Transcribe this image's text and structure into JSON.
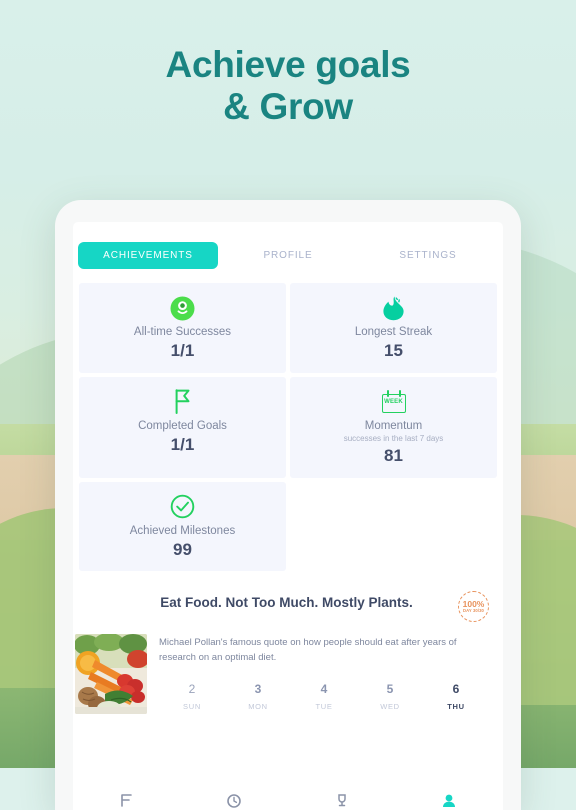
{
  "headline": {
    "line1": "Achieve goals",
    "line2": "& Grow"
  },
  "colors": {
    "headline_teal": "#1a8481",
    "tab_active_bg": "#16d6c5",
    "icon_green": "#3ddb52",
    "icon_teal": "#06cfa0",
    "badge_orange": "#e8925c",
    "card_bg": "#f4f6fd",
    "value_navy": "#454f6b"
  },
  "tabs": [
    {
      "label": "ACHIEVEMENTS",
      "active": true
    },
    {
      "label": "PROFILE",
      "active": false
    },
    {
      "label": "SETTINGS",
      "active": false
    }
  ],
  "stats": [
    {
      "icon": "monster-face-icon",
      "label": "All-time Successes",
      "sub": "",
      "value": "1/1"
    },
    {
      "icon": "flame-icon",
      "label": "Longest Streak",
      "sub": "",
      "value": "15"
    },
    {
      "icon": "flag-icon",
      "label": "Completed Goals",
      "sub": "",
      "value": "1/1"
    },
    {
      "icon": "calendar-week-icon",
      "label": "Momentum",
      "sub": "successes in the last 7 days",
      "value": "81"
    },
    {
      "icon": "check-circle-icon",
      "label": "Achieved Milestones",
      "sub": "",
      "value": "99"
    }
  ],
  "quote": {
    "title": "Eat Food. Not Too Much. Mostly Plants.",
    "description": "Michael Pollan's famous quote on how people should eat after years of research on an optimal diet.",
    "thumbnail_alt": "fresh-vegetables-photo",
    "badge": {
      "percent": "100%",
      "day": "DAY 30/30"
    }
  },
  "day_strip": [
    {
      "num": "2",
      "name": "SUN",
      "today": false
    },
    {
      "num": "3",
      "name": "MON",
      "today": false
    },
    {
      "num": "4",
      "name": "TUE",
      "today": false
    },
    {
      "num": "5",
      "name": "WED",
      "today": false
    },
    {
      "num": "6",
      "name": "THU",
      "today": true
    }
  ],
  "bottom_nav": [
    {
      "icon": "list-icon",
      "active": false
    },
    {
      "icon": "clock-icon",
      "active": false
    },
    {
      "icon": "trophy-icon",
      "active": false
    },
    {
      "icon": "profile-icon",
      "active": true
    }
  ]
}
